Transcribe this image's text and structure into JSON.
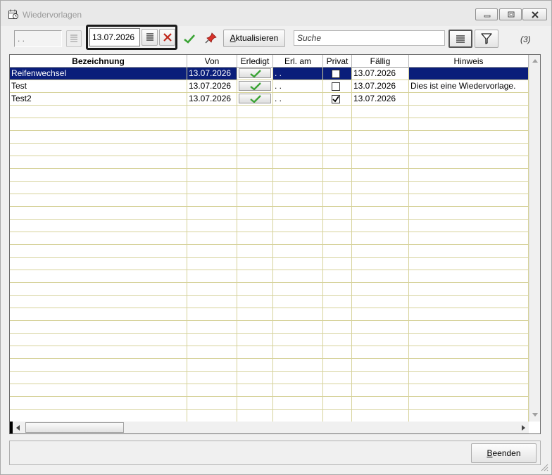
{
  "window": {
    "title": "Wiedervorlagen"
  },
  "toolbar": {
    "prev_label": ". .",
    "date_value": "13.07.2026",
    "refresh_label": "Aktualisieren",
    "refresh_mnemonic": "A",
    "refresh_rest": "ktualisieren",
    "search_placeholder": "Suche",
    "count": "(3)"
  },
  "table": {
    "columns": [
      "Bezeichnung",
      "Von",
      "Erledigt",
      "Erl. am",
      "Privat",
      "Fällig",
      "Hinweis"
    ],
    "rows": [
      {
        "bezeichnung": "Reifenwechsel",
        "von": "13.07.2026",
        "erl_am": ". .",
        "privat": false,
        "faellig": "13.07.2026",
        "hinweis": ""
      },
      {
        "bezeichnung": "Test",
        "von": "13.07.2026",
        "erl_am": ". .",
        "privat": false,
        "faellig": "13.07.2026",
        "hinweis": "Dies ist eine Wiedervorlage."
      },
      {
        "bezeichnung": "Test2",
        "von": "13.07.2026",
        "erl_am": ". .",
        "privat": true,
        "faellig": "13.07.2026",
        "hinweis": ""
      }
    ]
  },
  "footer": {
    "close_mnemonic": "B",
    "close_rest": "eenden"
  },
  "colors": {
    "selection": "#0a1e7a",
    "grid_line": "#d6d29a",
    "check_green": "#3aa334"
  }
}
